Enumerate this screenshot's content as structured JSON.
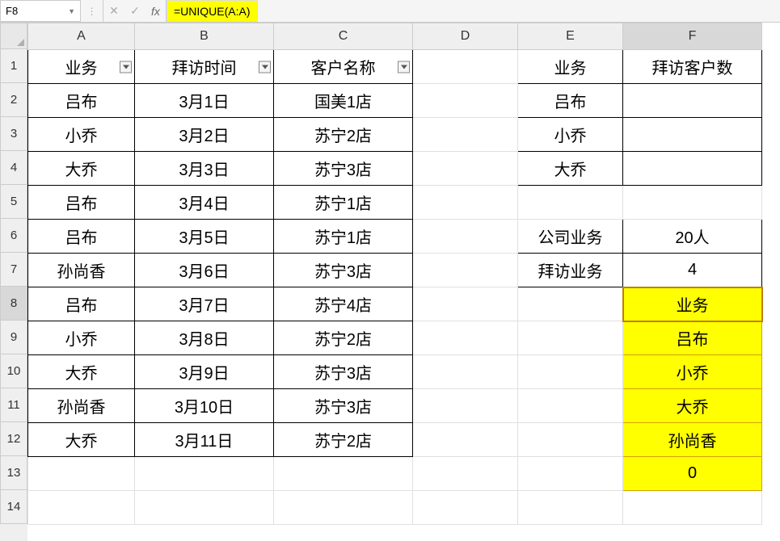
{
  "formula_bar": {
    "name_box": "F8",
    "fx_label": "fx",
    "formula": "=UNIQUE(A:A)"
  },
  "columns": [
    "A",
    "B",
    "C",
    "D",
    "E",
    "F"
  ],
  "rows": [
    "1",
    "2",
    "3",
    "4",
    "5",
    "6",
    "7",
    "8",
    "9",
    "10",
    "11",
    "12",
    "13",
    "14"
  ],
  "active_cell": {
    "row": 8,
    "col": "F"
  },
  "headers_abc": {
    "A": "业务",
    "B": "拜访时间",
    "C": "客户名称"
  },
  "table_abc": [
    {
      "A": "吕布",
      "B": "3月1日",
      "C": "国美1店"
    },
    {
      "A": "小乔",
      "B": "3月2日",
      "C": "苏宁2店"
    },
    {
      "A": "大乔",
      "B": "3月3日",
      "C": "苏宁3店"
    },
    {
      "A": "吕布",
      "B": "3月4日",
      "C": "苏宁1店"
    },
    {
      "A": "吕布",
      "B": "3月5日",
      "C": "苏宁1店"
    },
    {
      "A": "孙尚香",
      "B": "3月6日",
      "C": "苏宁3店"
    },
    {
      "A": "吕布",
      "B": "3月7日",
      "C": "苏宁4店"
    },
    {
      "A": "小乔",
      "B": "3月8日",
      "C": "苏宁2店"
    },
    {
      "A": "大乔",
      "B": "3月9日",
      "C": "苏宁3店"
    },
    {
      "A": "孙尚香",
      "B": "3月10日",
      "C": "苏宁3店"
    },
    {
      "A": "大乔",
      "B": "3月11日",
      "C": "苏宁2店"
    }
  ],
  "ef": {
    "1": {
      "E": "业务",
      "F": "拜访客户数"
    },
    "2": {
      "E": "吕布",
      "F": ""
    },
    "3": {
      "E": "小乔",
      "F": ""
    },
    "4": {
      "E": "大乔",
      "F": ""
    },
    "6": {
      "E": "公司业务",
      "F": "20人"
    },
    "7": {
      "E": "拜访业务",
      "F": "4"
    },
    "8": {
      "F": "业务"
    },
    "9": {
      "F": "吕布"
    },
    "10": {
      "F": "小乔"
    },
    "11": {
      "F": "大乔"
    },
    "12": {
      "F": "孙尚香"
    },
    "13": {
      "F": "0"
    }
  }
}
